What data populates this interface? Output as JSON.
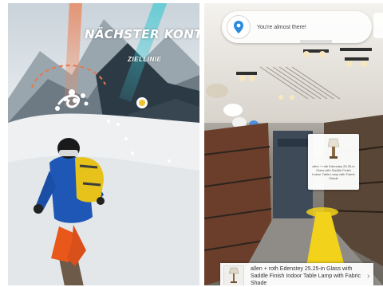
{
  "game": {
    "checkpoint_title": "NÄCHSTER KONTROLLPUNKT",
    "checkpoint_subtitle": "ZIELLINIE"
  },
  "store": {
    "notification": {
      "icon": "location-pin-icon",
      "text": "You're almost there!"
    },
    "product_card": {
      "text": "allen + roth Edenstey 25.25-in Glass with Saddle Finish Indoor Table Lamp with Fabric Shade"
    },
    "info_bar": {
      "text": "allen + roth Edenstey 25.25-in Glass with Saddle Finish Indoor Table Lamp with Fabric Shade",
      "arrow_icon": "chevron-right-icon"
    }
  },
  "colors": {
    "pin_blue": "#2b8bdc",
    "path_yellow": "#f2d21b",
    "jacket_blue": "#1f57b6",
    "pants_orange": "#e8581b",
    "backpack_yellow": "#e6c21a"
  }
}
